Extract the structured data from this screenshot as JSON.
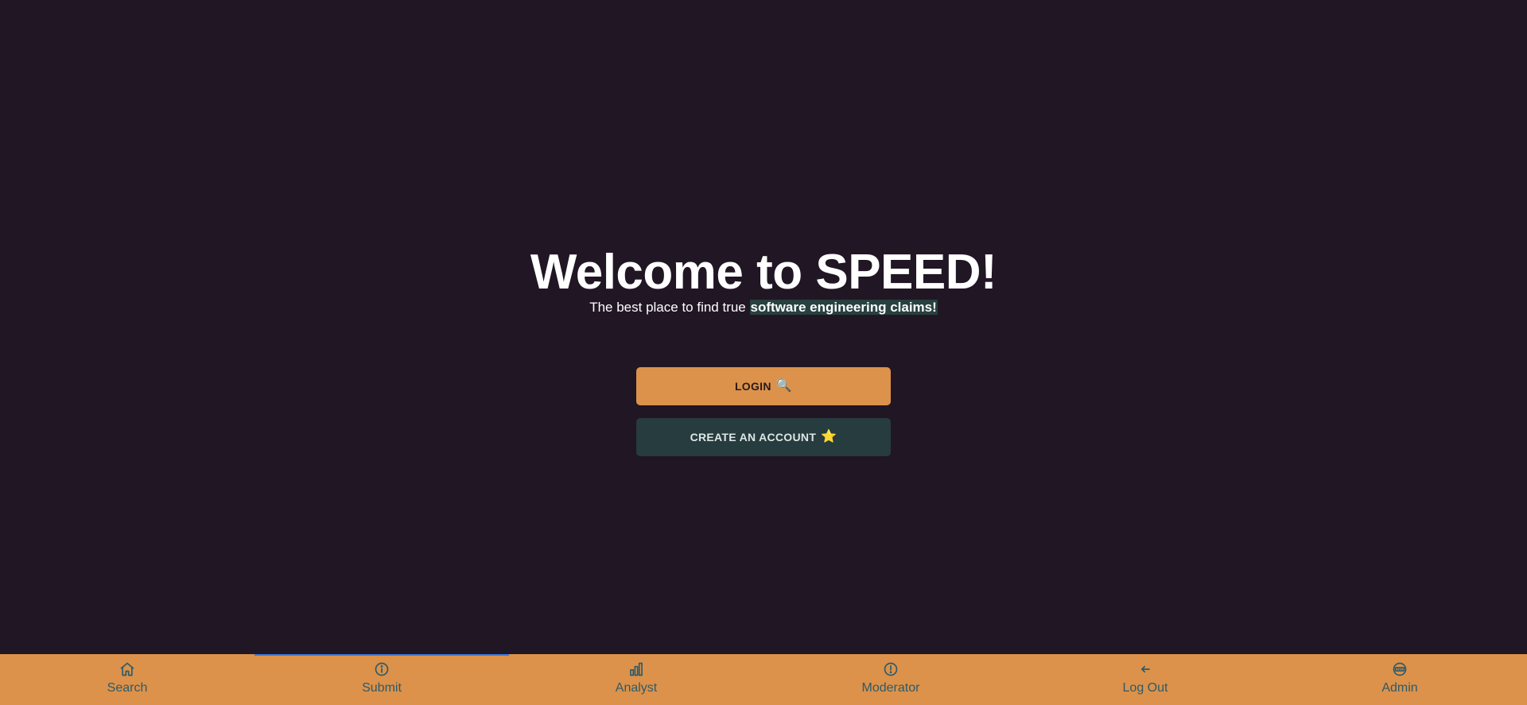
{
  "hero": {
    "title": "Welcome to SPEED!",
    "subtitle_prefix": "The best place to find true ",
    "subtitle_highlight": "software engineering claims!"
  },
  "buttons": {
    "login_label": "LOGIN",
    "login_icon": "🔍",
    "create_label": "CREATE AN ACCOUNT",
    "create_icon": "⭐"
  },
  "nav": {
    "items": [
      {
        "label": "Search",
        "icon": "home-icon"
      },
      {
        "label": "Submit",
        "icon": "info-icon",
        "active": true
      },
      {
        "label": "Analyst",
        "icon": "bar-chart-icon"
      },
      {
        "label": "Moderator",
        "icon": "alert-icon"
      },
      {
        "label": "Log Out",
        "icon": "arrow-left-icon"
      },
      {
        "label": "Admin",
        "icon": "admin-icon"
      }
    ]
  },
  "colors": {
    "background": "#211624",
    "accent": "#dc924a",
    "secondary": "#263c3e",
    "nav_text": "#2d5a6a",
    "active_indicator": "#3c78d8"
  }
}
